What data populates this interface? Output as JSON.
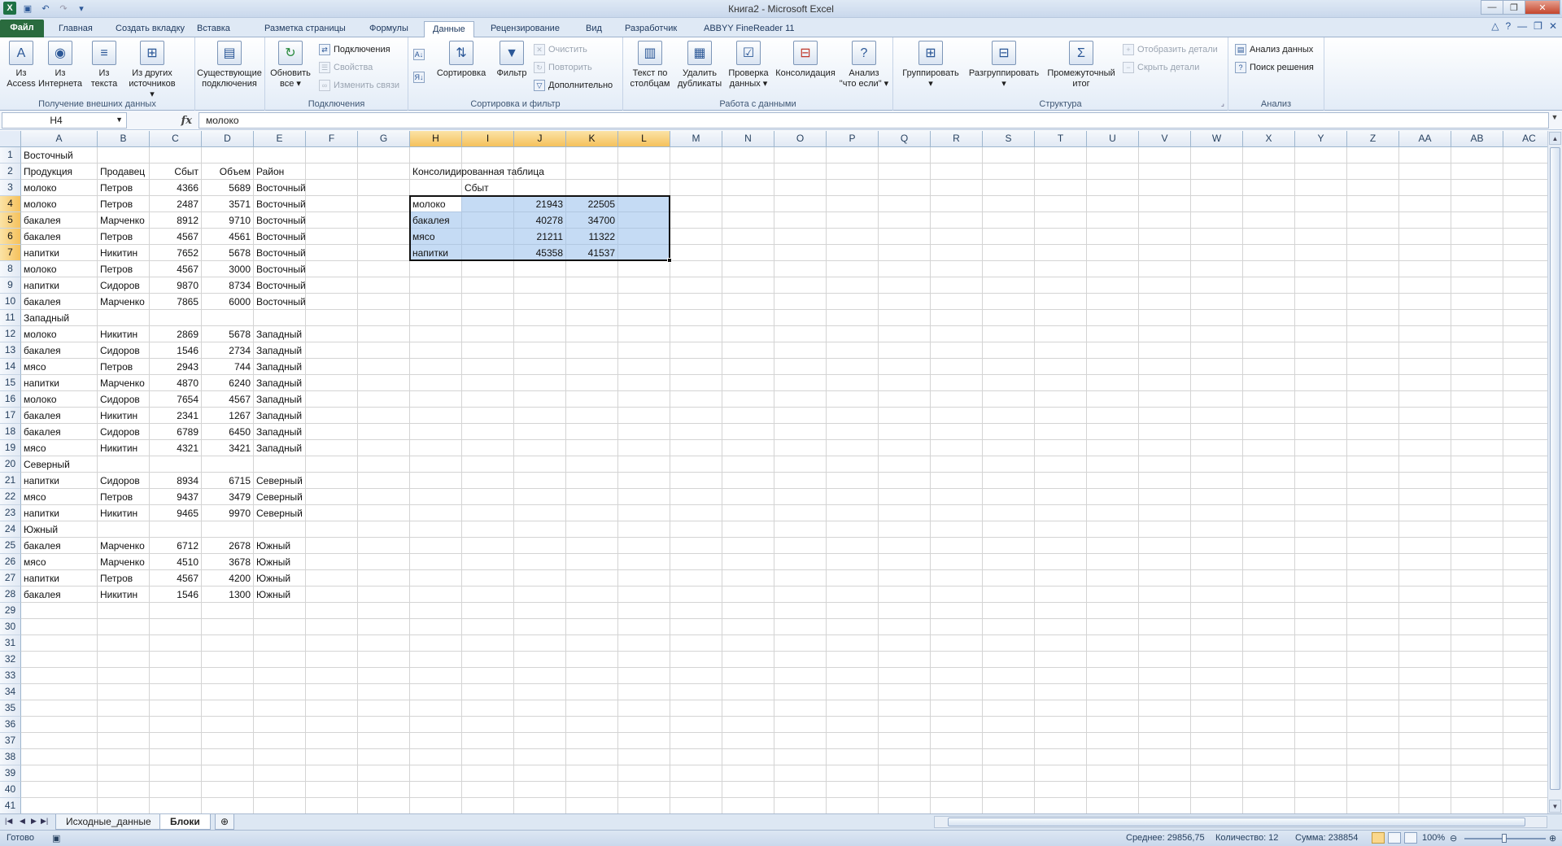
{
  "window": {
    "title": "Книга2 - Microsoft Excel",
    "qat": [
      "excel-logo",
      "save-icon",
      "undo-icon",
      "redo-icon",
      "customize-icon"
    ]
  },
  "tabs": {
    "file": "Файл",
    "items": [
      "Главная",
      "Создать вкладку",
      "Вставка",
      "Разметка страницы",
      "Формулы",
      "Данные",
      "Рецензирование",
      "Вид",
      "Разработчик",
      "ABBYY FineReader 11"
    ],
    "active": "Данные"
  },
  "ribbon": {
    "external": {
      "label": "Получение внешних данных",
      "access": "Из Access",
      "access_1": "Из",
      "access_2": "Access",
      "web_1": "Из",
      "web_2": "Интернета",
      "text_1": "Из",
      "text_2": "текста",
      "other_1": "Из других",
      "other_2": "источников",
      "existing_1": "Существующие",
      "existing_2": "подключения"
    },
    "connections": {
      "label": "Подключения",
      "refresh_1": "Обновить",
      "refresh_2": "все",
      "connections": "Подключения",
      "properties": "Свойства",
      "edit_links": "Изменить связи"
    },
    "sortfilter": {
      "label": "Сортировка и фильтр",
      "sort": "Сортировка",
      "filter": "Фильтр",
      "clear": "Очистить",
      "reapply": "Повторить",
      "advanced": "Дополнительно"
    },
    "datatools": {
      "label": "Работа с данными",
      "text_cols_1": "Текст по",
      "text_cols_2": "столбцам",
      "remove_dup_1": "Удалить",
      "remove_dup_2": "дубликаты",
      "validation_1": "Проверка",
      "validation_2": "данных",
      "consolidate": "Консолидация",
      "whatif_1": "Анализ",
      "whatif_2": "\"что если\""
    },
    "outline": {
      "label": "Структура",
      "group": "Группировать",
      "ungroup": "Разгруппировать",
      "subtotal_1": "Промежуточный",
      "subtotal_2": "итог",
      "show_detail": "Отобразить детали",
      "hide_detail": "Скрыть детали"
    },
    "analysis": {
      "label": "Анализ",
      "data_analysis": "Анализ данных",
      "solver": "Поиск решения"
    }
  },
  "formula_bar": {
    "name_box": "H4",
    "fx": "fx",
    "formula": "молоко"
  },
  "grid": {
    "columns": [
      "A",
      "B",
      "C",
      "D",
      "E",
      "F",
      "G",
      "H",
      "I",
      "J",
      "K",
      "L",
      "M",
      "N",
      "O",
      "P",
      "Q",
      "R",
      "S",
      "T",
      "U",
      "V",
      "W",
      "X",
      "Y",
      "Z",
      "AA",
      "AB",
      "AC"
    ],
    "selected_columns": [
      "H",
      "I",
      "J",
      "K",
      "L"
    ],
    "selected_rows": [
      4,
      5,
      6,
      7
    ],
    "row_count": 41,
    "cells": {
      "A1": "Восточный",
      "A2": "Продукция",
      "B2": "Продавец",
      "C2": "Сбыт",
      "D2": "Объем",
      "E2": "Район",
      "A3": "молоко",
      "B3": "Петров",
      "C3": "4366",
      "D3": "5689",
      "E3": "Восточный",
      "A4": "молоко",
      "B4": "Петров",
      "C4": "2487",
      "D4": "3571",
      "E4": "Восточный",
      "A5": "бакалея",
      "B5": "Марченко",
      "C5": "8912",
      "D5": "9710",
      "E5": "Восточный",
      "A6": "бакалея",
      "B6": "Петров",
      "C6": "4567",
      "D6": "4561",
      "E6": "Восточный",
      "A7": "напитки",
      "B7": "Никитин",
      "C7": "7652",
      "D7": "5678",
      "E7": "Восточный",
      "A8": "молоко",
      "B8": "Петров",
      "C8": "4567",
      "D8": "3000",
      "E8": "Восточный",
      "A9": "напитки",
      "B9": "Сидоров",
      "C9": "9870",
      "D9": "8734",
      "E9": "Восточный",
      "A10": "бакалея",
      "B10": "Марченко",
      "C10": "7865",
      "D10": "6000",
      "E10": "Восточный",
      "A11": "Западный",
      "A12": "молоко",
      "B12": "Никитин",
      "C12": "2869",
      "D12": "5678",
      "E12": "Западный",
      "A13": "бакалея",
      "B13": "Сидоров",
      "C13": "1546",
      "D13": "2734",
      "E13": "Западный",
      "A14": "мясо",
      "B14": "Петров",
      "C14": "2943",
      "D14": "744",
      "E14": "Западный",
      "A15": "напитки",
      "B15": "Марченко",
      "C15": "4870",
      "D15": "6240",
      "E15": "Западный",
      "A16": "молоко",
      "B16": "Сидоров",
      "C16": "7654",
      "D16": "4567",
      "E16": "Западный",
      "A17": "бакалея",
      "B17": "Никитин",
      "C17": "2341",
      "D17": "1267",
      "E17": "Западный",
      "A18": "бакалея",
      "B18": "Сидоров",
      "C18": "6789",
      "D18": "6450",
      "E18": "Западный",
      "A19": "мясо",
      "B19": "Никитин",
      "C19": "4321",
      "D19": "3421",
      "E19": "Западный",
      "A20": "Северный",
      "A21": "напитки",
      "B21": "Сидоров",
      "C21": "8934",
      "D21": "6715",
      "E21": "Северный",
      "A22": "мясо",
      "B22": "Петров",
      "C22": "9437",
      "D22": "3479",
      "E22": "Северный",
      "A23": "напитки",
      "B23": "Никитин",
      "C23": "9465",
      "D23": "9970",
      "E23": "Северный",
      "A24": "Южный",
      "A25": "бакалея",
      "B25": "Марченко",
      "C25": "6712",
      "D25": "2678",
      "E25": "Южный",
      "A26": "мясо",
      "B26": "Марченко",
      "C26": "4510",
      "D26": "3678",
      "E26": "Южный",
      "A27": "напитки",
      "B27": "Петров",
      "C27": "4567",
      "D27": "4200",
      "E27": "Южный",
      "A28": "бакалея",
      "B28": "Никитин",
      "C28": "1546",
      "D28": "1300",
      "E28": "Южный",
      "H2": "Консолидированная таблица",
      "I3": "Сбыт",
      "H4": "молоко",
      "J4": "21943",
      "K4": "22505",
      "H5": "бакалея",
      "J5": "40278",
      "K5": "34700",
      "H6": "мясо",
      "J6": "21211",
      "K6": "11322",
      "H7": "напитки",
      "J7": "45358",
      "K7": "41537"
    },
    "numeric_columns": [
      "C",
      "D",
      "J",
      "K"
    ]
  },
  "sheets": {
    "tabs": [
      "Исходные_данные",
      "Блоки"
    ],
    "active": "Блоки"
  },
  "status": {
    "ready": "Готово",
    "average": "Среднее: 29856,75",
    "count": "Количество: 12",
    "sum": "Сумма: 238854",
    "zoom": "100%"
  }
}
